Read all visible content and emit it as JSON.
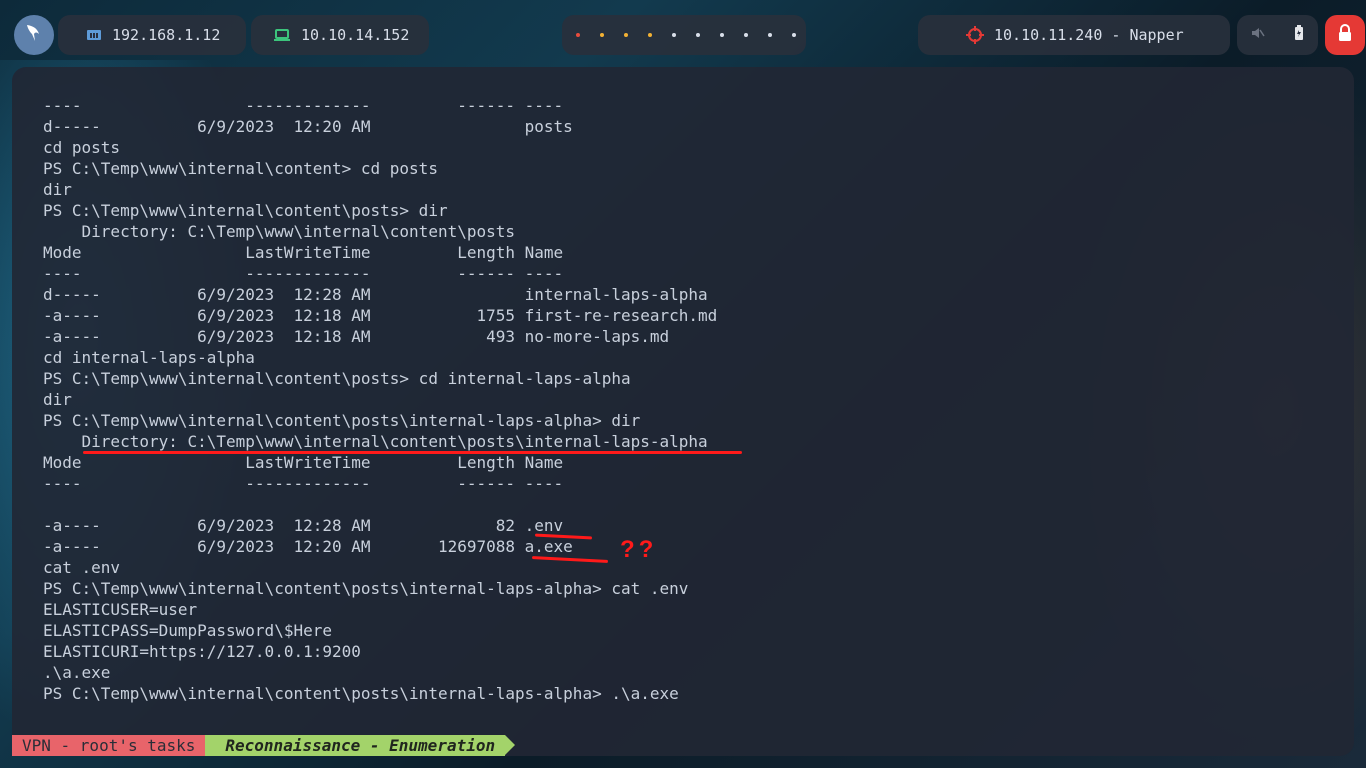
{
  "topbar": {
    "local_ip": "192.168.1.12",
    "vpn_ip": "10.10.14.152",
    "target": "10.10.11.240 - Napper",
    "workspace_dots": [
      "#e84c3d",
      "#f2b134",
      "#f2b134",
      "#f2b134",
      "#d8dee9",
      "#d8dee9",
      "#d8dee9",
      "#d8dee9",
      "#d8dee9",
      "#d8dee9"
    ]
  },
  "terminal": {
    "lines": [
      "----                 -------------         ------ ----",
      "d-----          6/9/2023  12:20 AM                posts",
      "cd posts",
      "PS C:\\Temp\\www\\internal\\content> cd posts",
      "dir",
      "PS C:\\Temp\\www\\internal\\content\\posts> dir",
      "    Directory: C:\\Temp\\www\\internal\\content\\posts",
      "Mode                 LastWriteTime         Length Name",
      "----                 -------------         ------ ----",
      "d-----          6/9/2023  12:28 AM                internal-laps-alpha",
      "-a----          6/9/2023  12:18 AM           1755 first-re-research.md",
      "-a----          6/9/2023  12:18 AM            493 no-more-laps.md",
      "cd internal-laps-alpha",
      "PS C:\\Temp\\www\\internal\\content\\posts> cd internal-laps-alpha",
      "dir",
      "PS C:\\Temp\\www\\internal\\content\\posts\\internal-laps-alpha> dir",
      "    Directory: C:\\Temp\\www\\internal\\content\\posts\\internal-laps-alpha",
      "Mode                 LastWriteTime         Length Name",
      "----                 -------------         ------ ----",
      "",
      "-a----          6/9/2023  12:28 AM             82 .env",
      "-a----          6/9/2023  12:20 AM       12697088 a.exe",
      "cat .env",
      "PS C:\\Temp\\www\\internal\\content\\posts\\internal-laps-alpha> cat .env",
      "ELASTICUSER=user",
      "ELASTICPASS=DumpPassword\\$Here",
      "ELASTICURI=https://127.0.0.1:9200",
      ".\\a.exe",
      "PS C:\\Temp\\www\\internal\\content\\posts\\internal-laps-alpha> .\\a.exe"
    ]
  },
  "annotation": {
    "question": "??"
  },
  "statusbar": {
    "session": "VPN - root's tasks",
    "window": "Reconnaissance - Enumeration"
  }
}
